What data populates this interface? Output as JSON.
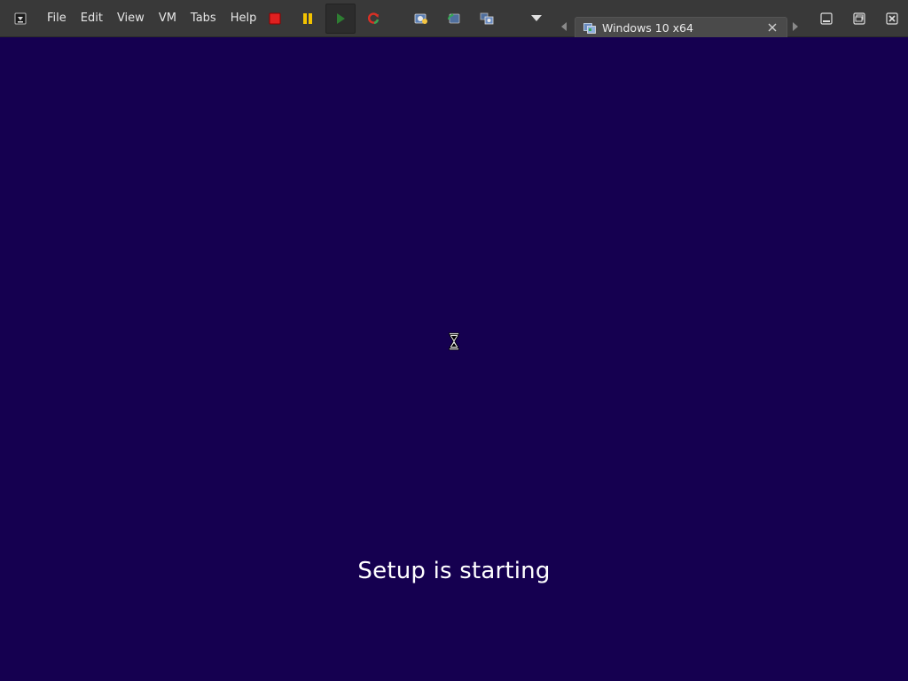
{
  "menu": {
    "items": [
      "File",
      "Edit",
      "View",
      "VM",
      "Tabs",
      "Help"
    ]
  },
  "toolbar": {
    "app_menu_icon": "hamburger-menu-icon",
    "vm_controls": [
      {
        "name": "power-off",
        "icon": "stop-icon",
        "color": "#e02020"
      },
      {
        "name": "suspend",
        "icon": "pause-icon",
        "color": "#f2c200"
      },
      {
        "name": "power-on",
        "icon": "play-icon",
        "color": "#2e7d32",
        "pressed": true
      },
      {
        "name": "reset",
        "icon": "reset-icon",
        "color": "#d93025"
      }
    ],
    "view_controls": [
      {
        "name": "snapshot",
        "icon": "snapshot-icon"
      },
      {
        "name": "revert-snapshot",
        "icon": "revert-snapshot-icon"
      },
      {
        "name": "snapshot-manager",
        "icon": "snapshot-manager-icon"
      }
    ]
  },
  "tab": {
    "label": "Windows 10 x64",
    "icon": "vm-icon"
  },
  "window_controls": [
    "minimize-icon",
    "restore-icon",
    "close-icon"
  ],
  "guest": {
    "background": "#150050",
    "status_text": "Setup is starting",
    "cursor": "hourglass-busy-cursor"
  }
}
